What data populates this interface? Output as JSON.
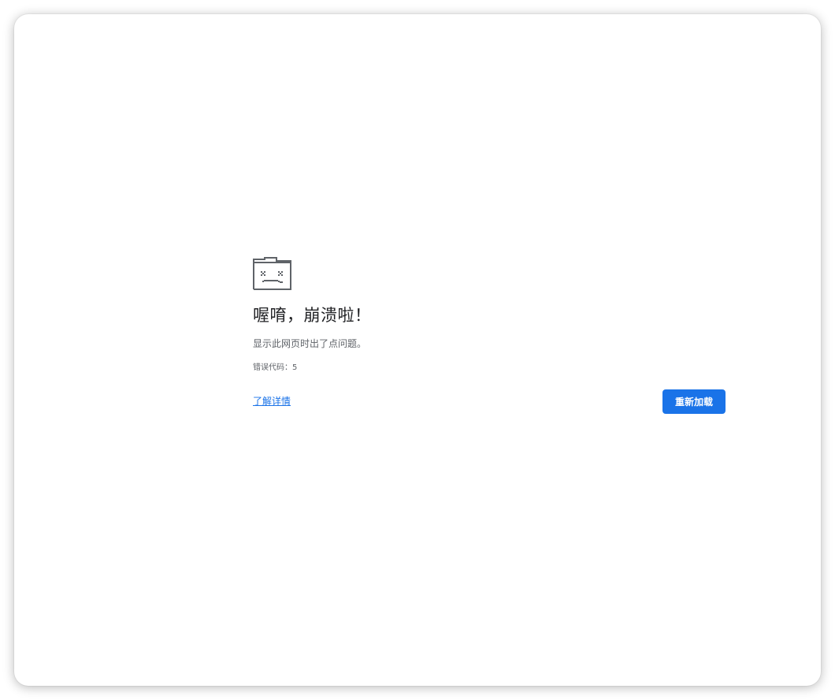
{
  "error_page": {
    "icon": "sad-tab-icon",
    "title": "喔唷，崩溃啦！",
    "subtitle": "显示此网页时出了点问题。",
    "error_code": "错误代码：5",
    "learn_more_label": "了解详情",
    "reload_label": "重新加载"
  },
  "colors": {
    "accent": "#1a73e8",
    "title_text": "#202124",
    "secondary_text": "#5f6368",
    "icon_gray": "#5f6368"
  }
}
